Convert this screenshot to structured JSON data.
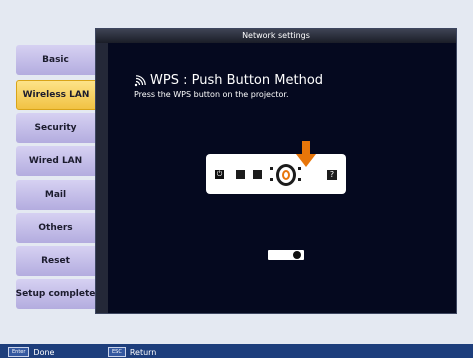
{
  "panel": {
    "title": "Network settings",
    "heading": "WPS : Push Button Method",
    "instruction": "Press the WPS button on the projector."
  },
  "nav": {
    "active_index": 1,
    "items": [
      {
        "label": "Basic"
      },
      {
        "label": "Wireless LAN"
      },
      {
        "label": "Security"
      },
      {
        "label": "Wired LAN"
      },
      {
        "label": "Mail"
      },
      {
        "label": "Others"
      },
      {
        "label": "Reset"
      },
      {
        "label": "Setup complete"
      }
    ]
  },
  "illustration": {
    "help_glyph": "?",
    "power_glyph": "⏻",
    "accent_color": "#e8760a",
    "toggle_state": "on"
  },
  "footer": {
    "enter_key": "Enter",
    "enter_action": "Done",
    "esc_key": "ESC",
    "esc_action": "Return"
  }
}
